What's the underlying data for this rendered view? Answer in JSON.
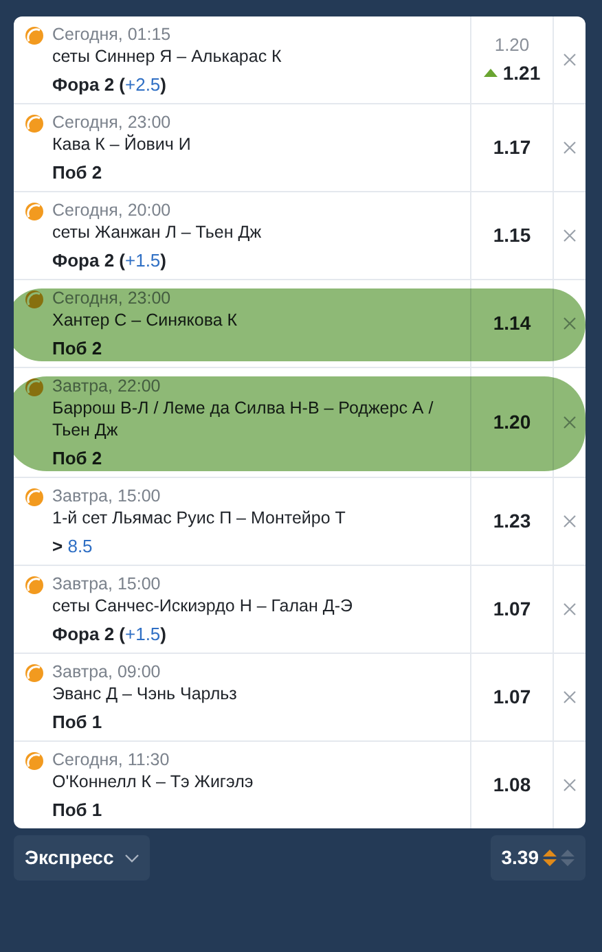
{
  "bets": [
    {
      "time": "Сегодня, 01:15",
      "event": "сеты Синнер Я – Алькарас К",
      "pick": [
        {
          "kind": "plain",
          "text": "Фора 2 ("
        },
        {
          "kind": "value",
          "text": "+2.5"
        },
        {
          "kind": "plain",
          "text": ")"
        }
      ],
      "old_odds": "1.20",
      "odds_rising": true,
      "odds": "1.21",
      "highlighted": false
    },
    {
      "time": "Сегодня, 23:00",
      "event": "Кава К – Йович И",
      "pick": [
        {
          "kind": "plain",
          "text": "Поб 2"
        }
      ],
      "odds": "1.17",
      "highlighted": false
    },
    {
      "time": "Сегодня, 20:00",
      "event": "сеты Жанжан Л – Тьен Дж",
      "pick": [
        {
          "kind": "plain",
          "text": "Фора 2 ("
        },
        {
          "kind": "value",
          "text": "+1.5"
        },
        {
          "kind": "plain",
          "text": ")"
        }
      ],
      "odds": "1.15",
      "highlighted": false
    },
    {
      "time": "Сегодня, 23:00",
      "event": "Хантер С – Синякова К",
      "pick": [
        {
          "kind": "plain",
          "text": "Поб 2"
        }
      ],
      "odds": "1.14",
      "highlighted": true
    },
    {
      "time": "Завтра, 22:00",
      "event": "Баррош В-Л / Леме да Силва Н-В – Роджерс А / Тьен Дж",
      "pick": [
        {
          "kind": "plain",
          "text": "Поб 2"
        }
      ],
      "odds": "1.20",
      "highlighted": true
    },
    {
      "time": "Завтра, 15:00",
      "event": "1-й сет Льямас Руис П – Монтейро Т",
      "pick": [
        {
          "kind": "plain",
          "text": "> "
        },
        {
          "kind": "value",
          "text": "8.5"
        }
      ],
      "odds": "1.23",
      "highlighted": false
    },
    {
      "time": "Завтра, 15:00",
      "event": "сеты Санчес-Искиэрдо Н – Галан Д-Э",
      "pick": [
        {
          "kind": "plain",
          "text": "Фора 2 ("
        },
        {
          "kind": "value",
          "text": "+1.5"
        },
        {
          "kind": "plain",
          "text": ")"
        }
      ],
      "odds": "1.07",
      "highlighted": false
    },
    {
      "time": "Завтра, 09:00",
      "event": "Эванс Д – Чэнь Чарльз",
      "pick": [
        {
          "kind": "plain",
          "text": "Поб 1"
        }
      ],
      "odds": "1.07",
      "highlighted": false
    },
    {
      "time": "Сегодня, 11:30",
      "event": "О'Коннелл К – Тэ Жигэлэ",
      "pick": [
        {
          "kind": "plain",
          "text": "Поб 1"
        }
      ],
      "odds": "1.08",
      "highlighted": false
    }
  ],
  "footer": {
    "bet_type": "Экспресс",
    "total_odds": "3.39"
  }
}
